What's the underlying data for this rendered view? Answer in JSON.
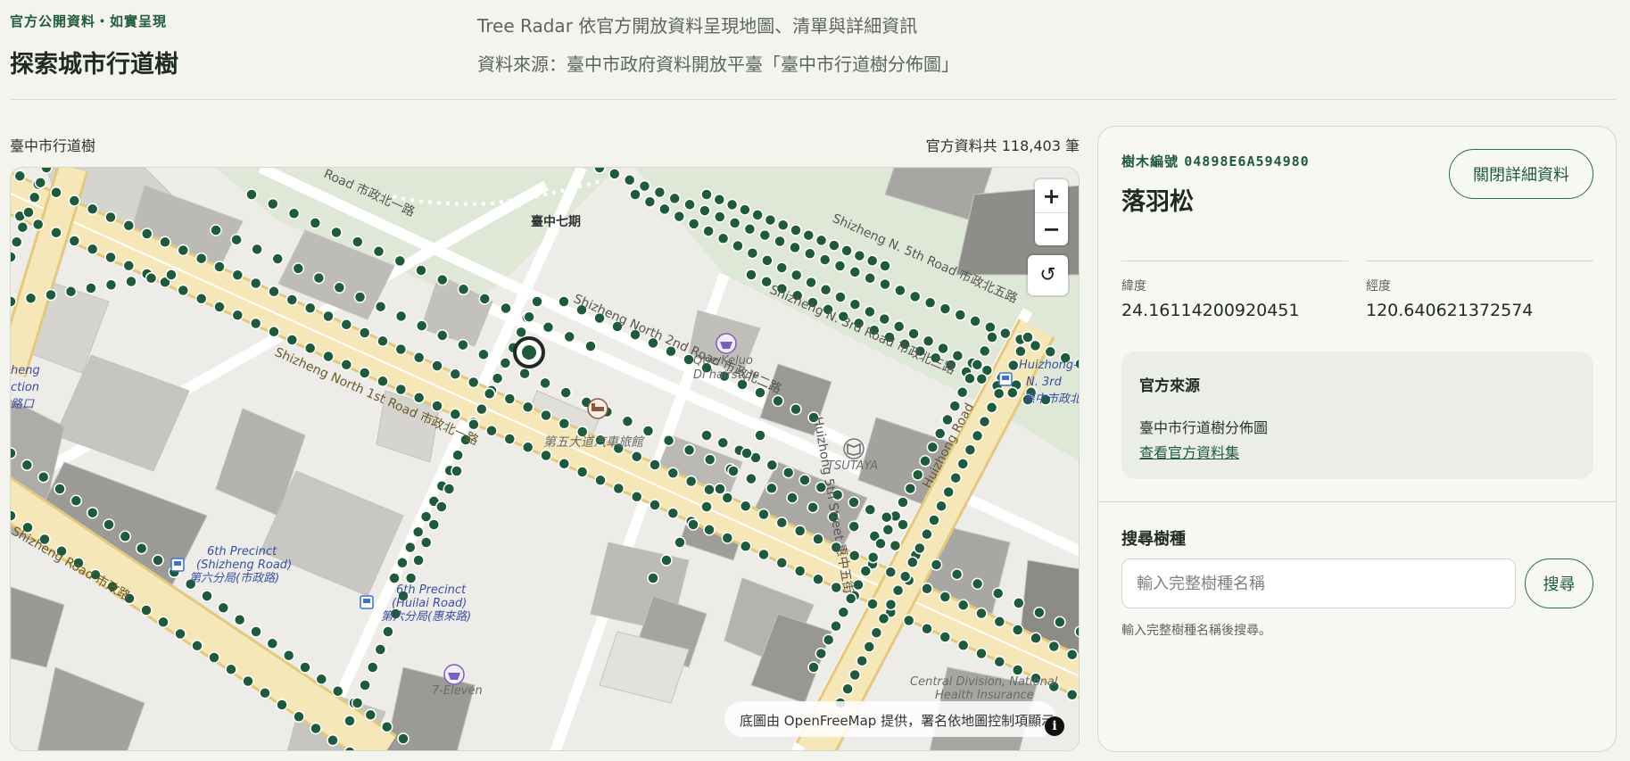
{
  "header": {
    "eyebrow": "官方公開資料・如實呈現",
    "title": "探索城市行道樹",
    "intro": "Tree Radar 依官方開放資料呈現地圖、清單與詳細資訊",
    "source": "資料來源：臺中市政府資料開放平臺「臺中市行道樹分佈圖」"
  },
  "map": {
    "label": "臺中市行道樹",
    "count": "官方資料共 118,403 筆",
    "zoom_in": "+",
    "zoom_out": "−",
    "reset": "↺",
    "attribution": "底圖由 OpenFreeMap 提供，署名依地圖控制項顯示",
    "info": "i",
    "labels": {
      "park": "臺中七期",
      "hotel": "第五大道汽車旅館",
      "shop1": "Qtie Keluo",
      "shop2": "Di hairstyle",
      "bookstore": "TSUTAYA",
      "police1a": "6th Precinct",
      "police1b": "(Shizheng Road)",
      "police1c": "第六分局(市政路)",
      "police2a": "6th Precinct",
      "police2b": "(Huilai Road)",
      "police2c": "第六分局(惠來路)",
      "store": "7-Eleven",
      "nhi1": "Central Division, National",
      "nhi2": "Health Insurance",
      "road1": "Shizheng North 1st Road 市政北一路",
      "road2": "Shizheng North 2nd Road 市政北二路",
      "road3": "Shizheng N. 3rd Road 市政北三路",
      "road4": "Shizheng N. 5th Road 市政北五路",
      "road5": "Huizhong 5th Street 惠中五街",
      "road6": "Road 市政北一路",
      "road7": "Shizheng Road 市政路",
      "road8": "Huizhong Road",
      "edge1": "heng",
      "edge2": "ction",
      "edge3": "路口",
      "edge4": "Huizhong-S",
      "edge5": "N. 3rd",
      "edge6": "惠中市政北"
    },
    "icons": {
      "hotel": "bed-icon",
      "shop": "basket-icon",
      "bookstore": "book-icon",
      "bus": "bus-icon",
      "selected": "selected-tree-marker-icon"
    },
    "colors": {
      "tree": "#1f5a3c",
      "road_fill": "#f6e7b8",
      "road_edge": "#e3c97e",
      "park": "#dfe8d7",
      "poi": "#7b5fc2"
    }
  },
  "detail": {
    "tree_id_label": "樹木編號",
    "tree_id": "04898E6A594980",
    "species": "落羽松",
    "close_label": "關閉詳細資料",
    "lat_label": "緯度",
    "lat_value": "24.16114200920451",
    "lng_label": "經度",
    "lng_value": "120.640621372574",
    "source_title": "官方來源",
    "source_name": "臺中市行道樹分佈圖",
    "source_link": "查看官方資料集"
  },
  "search": {
    "title": "搜尋樹種",
    "placeholder": "輸入完整樹種名稱",
    "button": "搜尋",
    "hint": "輸入完整樹種名稱後搜尋。"
  }
}
